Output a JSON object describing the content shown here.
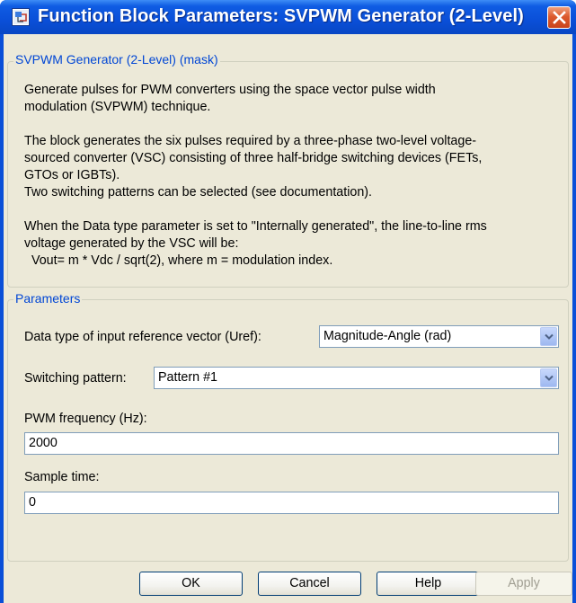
{
  "window": {
    "title": "Function Block Parameters: SVPWM Generator (2-Level)",
    "icon": "simulink-block-icon",
    "close_icon": "close-icon"
  },
  "mask_group": {
    "legend": "SVPWM Generator (2-Level) (mask)",
    "description_lines": [
      "Generate pulses for PWM converters using the space vector pulse width",
      "modulation (SVPWM) technique.",
      "",
      "The block generates the six pulses required by a three-phase two-level voltage-",
      "sourced converter (VSC) consisting of three half-bridge switching devices (FETs,",
      "GTOs or IGBTs).",
      "Two switching patterns can be selected (see documentation).",
      "",
      "When the Data type parameter is set to \"Internally generated\", the line-to-line rms",
      "voltage generated by the VSC will be:",
      "  Vout= m * Vdc / sqrt(2), where m = modulation index."
    ]
  },
  "parameters": {
    "legend": "Parameters",
    "data_type_label": "Data type of input reference vector (Uref):",
    "data_type_value": "Magnitude-Angle (rad)",
    "switching_label": "Switching pattern:",
    "switching_value": "Pattern #1",
    "pwm_freq_label": "PWM frequency (Hz):",
    "pwm_freq_value": "2000",
    "sample_time_label": "Sample time:",
    "sample_time_value": "0"
  },
  "buttons": {
    "ok": "OK",
    "cancel": "Cancel",
    "help": "Help",
    "apply": "Apply"
  },
  "colors": {
    "titlebar": "#0a4fd8",
    "dialog_face": "#ece9d8",
    "legend_text": "#0046d5",
    "input_border": "#7f9db9"
  }
}
